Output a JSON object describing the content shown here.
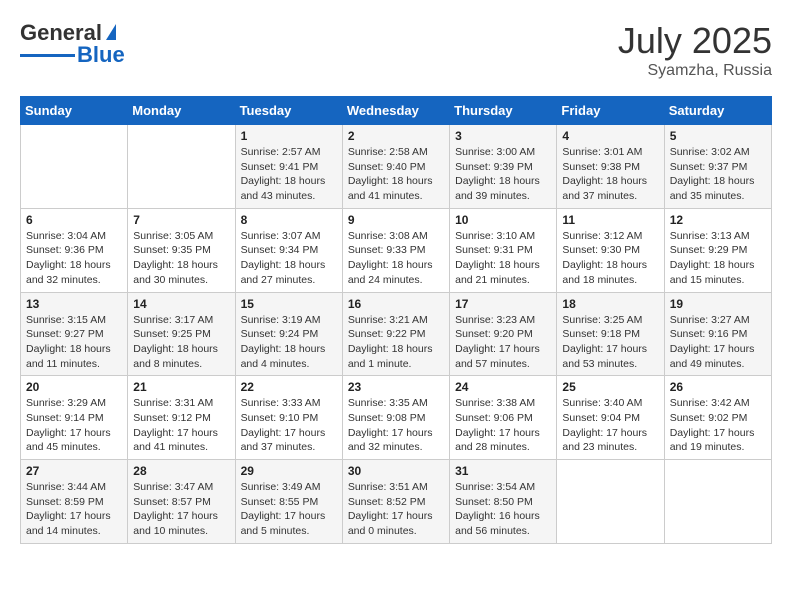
{
  "header": {
    "logo_general": "General",
    "logo_blue": "Blue",
    "month_year": "July 2025",
    "location": "Syamzha, Russia"
  },
  "weekdays": [
    "Sunday",
    "Monday",
    "Tuesday",
    "Wednesday",
    "Thursday",
    "Friday",
    "Saturday"
  ],
  "weeks": [
    [
      {
        "day": "",
        "info": ""
      },
      {
        "day": "",
        "info": ""
      },
      {
        "day": "1",
        "info": "Sunrise: 2:57 AM\nSunset: 9:41 PM\nDaylight: 18 hours and 43 minutes."
      },
      {
        "day": "2",
        "info": "Sunrise: 2:58 AM\nSunset: 9:40 PM\nDaylight: 18 hours and 41 minutes."
      },
      {
        "day": "3",
        "info": "Sunrise: 3:00 AM\nSunset: 9:39 PM\nDaylight: 18 hours and 39 minutes."
      },
      {
        "day": "4",
        "info": "Sunrise: 3:01 AM\nSunset: 9:38 PM\nDaylight: 18 hours and 37 minutes."
      },
      {
        "day": "5",
        "info": "Sunrise: 3:02 AM\nSunset: 9:37 PM\nDaylight: 18 hours and 35 minutes."
      }
    ],
    [
      {
        "day": "6",
        "info": "Sunrise: 3:04 AM\nSunset: 9:36 PM\nDaylight: 18 hours and 32 minutes."
      },
      {
        "day": "7",
        "info": "Sunrise: 3:05 AM\nSunset: 9:35 PM\nDaylight: 18 hours and 30 minutes."
      },
      {
        "day": "8",
        "info": "Sunrise: 3:07 AM\nSunset: 9:34 PM\nDaylight: 18 hours and 27 minutes."
      },
      {
        "day": "9",
        "info": "Sunrise: 3:08 AM\nSunset: 9:33 PM\nDaylight: 18 hours and 24 minutes."
      },
      {
        "day": "10",
        "info": "Sunrise: 3:10 AM\nSunset: 9:31 PM\nDaylight: 18 hours and 21 minutes."
      },
      {
        "day": "11",
        "info": "Sunrise: 3:12 AM\nSunset: 9:30 PM\nDaylight: 18 hours and 18 minutes."
      },
      {
        "day": "12",
        "info": "Sunrise: 3:13 AM\nSunset: 9:29 PM\nDaylight: 18 hours and 15 minutes."
      }
    ],
    [
      {
        "day": "13",
        "info": "Sunrise: 3:15 AM\nSunset: 9:27 PM\nDaylight: 18 hours and 11 minutes."
      },
      {
        "day": "14",
        "info": "Sunrise: 3:17 AM\nSunset: 9:25 PM\nDaylight: 18 hours and 8 minutes."
      },
      {
        "day": "15",
        "info": "Sunrise: 3:19 AM\nSunset: 9:24 PM\nDaylight: 18 hours and 4 minutes."
      },
      {
        "day": "16",
        "info": "Sunrise: 3:21 AM\nSunset: 9:22 PM\nDaylight: 18 hours and 1 minute."
      },
      {
        "day": "17",
        "info": "Sunrise: 3:23 AM\nSunset: 9:20 PM\nDaylight: 17 hours and 57 minutes."
      },
      {
        "day": "18",
        "info": "Sunrise: 3:25 AM\nSunset: 9:18 PM\nDaylight: 17 hours and 53 minutes."
      },
      {
        "day": "19",
        "info": "Sunrise: 3:27 AM\nSunset: 9:16 PM\nDaylight: 17 hours and 49 minutes."
      }
    ],
    [
      {
        "day": "20",
        "info": "Sunrise: 3:29 AM\nSunset: 9:14 PM\nDaylight: 17 hours and 45 minutes."
      },
      {
        "day": "21",
        "info": "Sunrise: 3:31 AM\nSunset: 9:12 PM\nDaylight: 17 hours and 41 minutes."
      },
      {
        "day": "22",
        "info": "Sunrise: 3:33 AM\nSunset: 9:10 PM\nDaylight: 17 hours and 37 minutes."
      },
      {
        "day": "23",
        "info": "Sunrise: 3:35 AM\nSunset: 9:08 PM\nDaylight: 17 hours and 32 minutes."
      },
      {
        "day": "24",
        "info": "Sunrise: 3:38 AM\nSunset: 9:06 PM\nDaylight: 17 hours and 28 minutes."
      },
      {
        "day": "25",
        "info": "Sunrise: 3:40 AM\nSunset: 9:04 PM\nDaylight: 17 hours and 23 minutes."
      },
      {
        "day": "26",
        "info": "Sunrise: 3:42 AM\nSunset: 9:02 PM\nDaylight: 17 hours and 19 minutes."
      }
    ],
    [
      {
        "day": "27",
        "info": "Sunrise: 3:44 AM\nSunset: 8:59 PM\nDaylight: 17 hours and 14 minutes."
      },
      {
        "day": "28",
        "info": "Sunrise: 3:47 AM\nSunset: 8:57 PM\nDaylight: 17 hours and 10 minutes."
      },
      {
        "day": "29",
        "info": "Sunrise: 3:49 AM\nSunset: 8:55 PM\nDaylight: 17 hours and 5 minutes."
      },
      {
        "day": "30",
        "info": "Sunrise: 3:51 AM\nSunset: 8:52 PM\nDaylight: 17 hours and 0 minutes."
      },
      {
        "day": "31",
        "info": "Sunrise: 3:54 AM\nSunset: 8:50 PM\nDaylight: 16 hours and 56 minutes."
      },
      {
        "day": "",
        "info": ""
      },
      {
        "day": "",
        "info": ""
      }
    ]
  ]
}
